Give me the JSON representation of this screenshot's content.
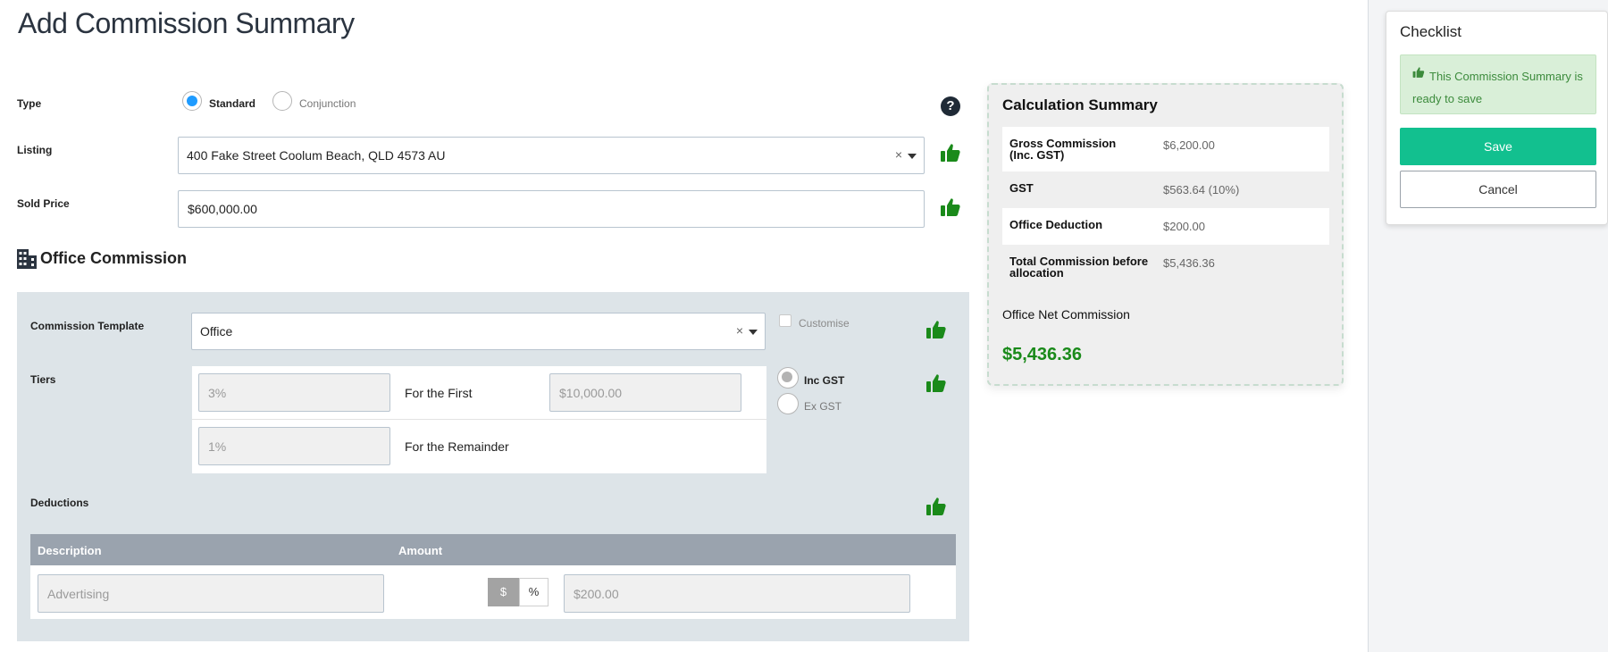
{
  "page": {
    "title": "Add Commission Summary"
  },
  "form": {
    "type": {
      "label": "Type",
      "options": [
        {
          "label": "Standard",
          "selected": true
        },
        {
          "label": "Conjunction",
          "selected": false
        }
      ]
    },
    "listing": {
      "label": "Listing",
      "value": "400 Fake Street Coolum Beach, QLD 4573 AU",
      "clear": "×"
    },
    "sold_price": {
      "label": "Sold Price",
      "value": "$600,000.00"
    },
    "help": "?"
  },
  "office_commission": {
    "heading": "Office Commission",
    "template": {
      "label": "Commission Template",
      "value": "Office",
      "clear": "×",
      "customise_label": "Customise",
      "customise_checked": false
    },
    "tiers": {
      "label": "Tiers",
      "rows": [
        {
          "rate": "3%",
          "text": "For the First",
          "amount": "$10,000.00"
        },
        {
          "rate": "1%",
          "text": "For the Remainder"
        }
      ],
      "gst_options": [
        {
          "label": "Inc GST",
          "selected": true
        },
        {
          "label": "Ex GST",
          "selected": false
        }
      ]
    },
    "deductions": {
      "label": "Deductions",
      "columns": [
        "Description",
        "Amount"
      ],
      "rows": [
        {
          "description": "Advertising",
          "unit_options": [
            "$",
            "%"
          ],
          "unit_selected": "$",
          "amount": "$200.00"
        }
      ]
    }
  },
  "calculation": {
    "title": "Calculation Summary",
    "rows": [
      {
        "label": "Gross Commission (Inc. GST)",
        "value": "$6,200.00"
      },
      {
        "label": "GST",
        "value": "$563.64 (10%)"
      },
      {
        "label": "Office Deduction",
        "value": "$200.00"
      },
      {
        "label": "Total Commission before allocation",
        "value": "$5,436.36"
      }
    ],
    "net_label": "Office Net Commission",
    "net_value": "$5,436.36"
  },
  "checklist": {
    "title": "Checklist",
    "message": "This Commission Summary is ready to save",
    "save_label": "Save",
    "cancel_label": "Cancel"
  },
  "colors": {
    "thumb_green": "#1a8a1a",
    "net_green": "#1a8a1a",
    "save_button": "#12c08f",
    "radio_blue": "#1e9bff",
    "alert_bg": "#d9efd8",
    "alert_text": "#3c8b3c"
  },
  "icons": {
    "valid": "thumbs-up-icon",
    "help": "question-circle-icon",
    "building": "building-icon"
  }
}
